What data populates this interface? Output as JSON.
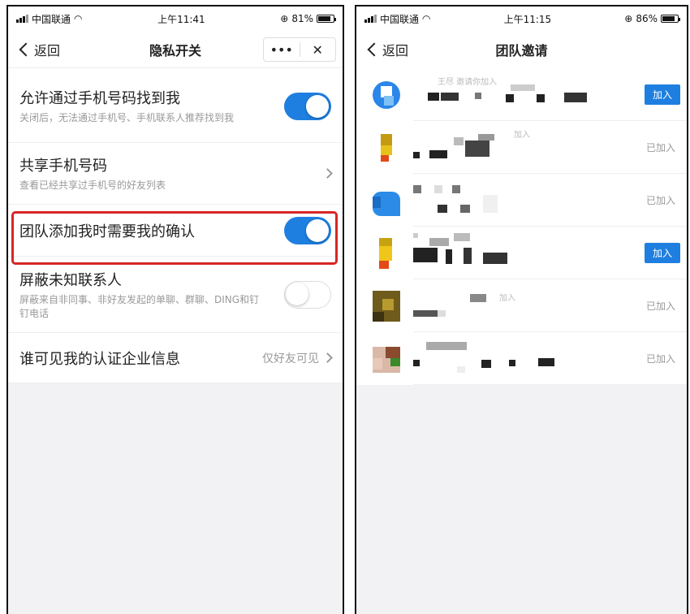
{
  "left_phone": {
    "status": {
      "carrier": "中国联通",
      "time": "上午11:41",
      "battery": "81%",
      "battery_level": 0.81
    },
    "nav": {
      "back_label": "返回",
      "title": "隐私开关",
      "more": "•••",
      "close": "✕"
    },
    "settings": [
      {
        "title": "允许通过手机号码找到我",
        "desc": "关闭后，无法通过手机号、手机联系人推荐找到我",
        "toggle": "on"
      },
      {
        "title": "共享手机号码",
        "desc": "查看已经共享过手机号的好友列表",
        "toggle": "chevron"
      },
      {
        "title": "团队添加我时需要我的确认",
        "desc": "",
        "toggle": "on",
        "highlighted": true
      },
      {
        "title": "屏蔽未知联系人",
        "desc": "屏蔽来自非同事、非好友发起的单聊、群聊、DING和钉钉电话",
        "toggle": "off"
      },
      {
        "title": "谁可见我的认证企业信息",
        "value": "仅好友可见",
        "toggle": "chevron"
      }
    ]
  },
  "right_phone": {
    "status": {
      "carrier": "中国联通",
      "time": "上午11:15",
      "battery": "86%",
      "battery_level": 0.86
    },
    "nav": {
      "back_label": "返回",
      "title": "团队邀请"
    },
    "invites": [
      {
        "action": "加入",
        "state": "join",
        "snippet": "王尽 邀请你加入"
      },
      {
        "action": "已加入",
        "state": "joined",
        "snippet": "加入"
      },
      {
        "action": "已加入",
        "state": "joined",
        "snippet": ""
      },
      {
        "action": "加入",
        "state": "join",
        "snippet": ""
      },
      {
        "action": "已加入",
        "state": "joined",
        "snippet": "加入"
      },
      {
        "action": "已加入",
        "state": "joined",
        "snippet": ""
      }
    ]
  },
  "colors": {
    "accent": "#1e7fe0",
    "highlight": "#d82626",
    "background": "#f2f2f4"
  }
}
